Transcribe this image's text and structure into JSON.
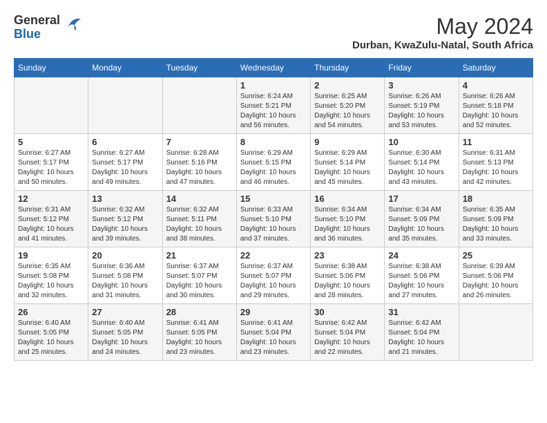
{
  "header": {
    "logo_line1": "General",
    "logo_line2": "Blue",
    "month_year": "May 2024",
    "location": "Durban, KwaZulu-Natal, South Africa"
  },
  "days_of_week": [
    "Sunday",
    "Monday",
    "Tuesday",
    "Wednesday",
    "Thursday",
    "Friday",
    "Saturday"
  ],
  "weeks": [
    [
      {
        "day": "",
        "info": ""
      },
      {
        "day": "",
        "info": ""
      },
      {
        "day": "",
        "info": ""
      },
      {
        "day": "1",
        "info": "Sunrise: 6:24 AM\nSunset: 5:21 PM\nDaylight: 10 hours\nand 56 minutes."
      },
      {
        "day": "2",
        "info": "Sunrise: 6:25 AM\nSunset: 5:20 PM\nDaylight: 10 hours\nand 54 minutes."
      },
      {
        "day": "3",
        "info": "Sunrise: 6:26 AM\nSunset: 5:19 PM\nDaylight: 10 hours\nand 53 minutes."
      },
      {
        "day": "4",
        "info": "Sunrise: 6:26 AM\nSunset: 5:18 PM\nDaylight: 10 hours\nand 52 minutes."
      }
    ],
    [
      {
        "day": "5",
        "info": "Sunrise: 6:27 AM\nSunset: 5:17 PM\nDaylight: 10 hours\nand 50 minutes."
      },
      {
        "day": "6",
        "info": "Sunrise: 6:27 AM\nSunset: 5:17 PM\nDaylight: 10 hours\nand 49 minutes."
      },
      {
        "day": "7",
        "info": "Sunrise: 6:28 AM\nSunset: 5:16 PM\nDaylight: 10 hours\nand 47 minutes."
      },
      {
        "day": "8",
        "info": "Sunrise: 6:29 AM\nSunset: 5:15 PM\nDaylight: 10 hours\nand 46 minutes."
      },
      {
        "day": "9",
        "info": "Sunrise: 6:29 AM\nSunset: 5:14 PM\nDaylight: 10 hours\nand 45 minutes."
      },
      {
        "day": "10",
        "info": "Sunrise: 6:30 AM\nSunset: 5:14 PM\nDaylight: 10 hours\nand 43 minutes."
      },
      {
        "day": "11",
        "info": "Sunrise: 6:31 AM\nSunset: 5:13 PM\nDaylight: 10 hours\nand 42 minutes."
      }
    ],
    [
      {
        "day": "12",
        "info": "Sunrise: 6:31 AM\nSunset: 5:12 PM\nDaylight: 10 hours\nand 41 minutes."
      },
      {
        "day": "13",
        "info": "Sunrise: 6:32 AM\nSunset: 5:12 PM\nDaylight: 10 hours\nand 39 minutes."
      },
      {
        "day": "14",
        "info": "Sunrise: 6:32 AM\nSunset: 5:11 PM\nDaylight: 10 hours\nand 38 minutes."
      },
      {
        "day": "15",
        "info": "Sunrise: 6:33 AM\nSunset: 5:10 PM\nDaylight: 10 hours\nand 37 minutes."
      },
      {
        "day": "16",
        "info": "Sunrise: 6:34 AM\nSunset: 5:10 PM\nDaylight: 10 hours\nand 36 minutes."
      },
      {
        "day": "17",
        "info": "Sunrise: 6:34 AM\nSunset: 5:09 PM\nDaylight: 10 hours\nand 35 minutes."
      },
      {
        "day": "18",
        "info": "Sunrise: 6:35 AM\nSunset: 5:09 PM\nDaylight: 10 hours\nand 33 minutes."
      }
    ],
    [
      {
        "day": "19",
        "info": "Sunrise: 6:35 AM\nSunset: 5:08 PM\nDaylight: 10 hours\nand 32 minutes."
      },
      {
        "day": "20",
        "info": "Sunrise: 6:36 AM\nSunset: 5:08 PM\nDaylight: 10 hours\nand 31 minutes."
      },
      {
        "day": "21",
        "info": "Sunrise: 6:37 AM\nSunset: 5:07 PM\nDaylight: 10 hours\nand 30 minutes."
      },
      {
        "day": "22",
        "info": "Sunrise: 6:37 AM\nSunset: 5:07 PM\nDaylight: 10 hours\nand 29 minutes."
      },
      {
        "day": "23",
        "info": "Sunrise: 6:38 AM\nSunset: 5:06 PM\nDaylight: 10 hours\nand 28 minutes."
      },
      {
        "day": "24",
        "info": "Sunrise: 6:38 AM\nSunset: 5:06 PM\nDaylight: 10 hours\nand 27 minutes."
      },
      {
        "day": "25",
        "info": "Sunrise: 6:39 AM\nSunset: 5:06 PM\nDaylight: 10 hours\nand 26 minutes."
      }
    ],
    [
      {
        "day": "26",
        "info": "Sunrise: 6:40 AM\nSunset: 5:05 PM\nDaylight: 10 hours\nand 25 minutes."
      },
      {
        "day": "27",
        "info": "Sunrise: 6:40 AM\nSunset: 5:05 PM\nDaylight: 10 hours\nand 24 minutes."
      },
      {
        "day": "28",
        "info": "Sunrise: 6:41 AM\nSunset: 5:05 PM\nDaylight: 10 hours\nand 23 minutes."
      },
      {
        "day": "29",
        "info": "Sunrise: 6:41 AM\nSunset: 5:04 PM\nDaylight: 10 hours\nand 23 minutes."
      },
      {
        "day": "30",
        "info": "Sunrise: 6:42 AM\nSunset: 5:04 PM\nDaylight: 10 hours\nand 22 minutes."
      },
      {
        "day": "31",
        "info": "Sunrise: 6:42 AM\nSunset: 5:04 PM\nDaylight: 10 hours\nand 21 minutes."
      },
      {
        "day": "",
        "info": ""
      }
    ]
  ]
}
